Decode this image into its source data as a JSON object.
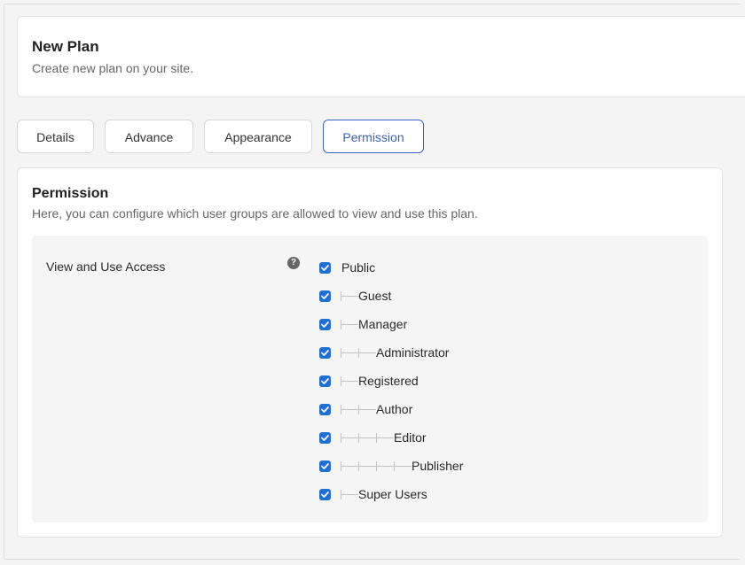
{
  "header": {
    "title": "New Plan",
    "subtitle": "Create new plan on your site."
  },
  "tabs": [
    {
      "label": "Details",
      "active": false
    },
    {
      "label": "Advance",
      "active": false
    },
    {
      "label": "Appearance",
      "active": false
    },
    {
      "label": "Permission",
      "active": true
    }
  ],
  "panel": {
    "title": "Permission",
    "description": "Here, you can configure which user groups are allowed to view and use this plan."
  },
  "field": {
    "label": "View and Use Access",
    "help_icon": "question-circle-icon"
  },
  "groups": [
    {
      "label": "Public",
      "level": 0,
      "checked": true
    },
    {
      "label": "Guest",
      "level": 1,
      "checked": true
    },
    {
      "label": "Manager",
      "level": 1,
      "checked": true
    },
    {
      "label": "Administrator",
      "level": 2,
      "checked": true
    },
    {
      "label": "Registered",
      "level": 1,
      "checked": true
    },
    {
      "label": "Author",
      "level": 2,
      "checked": true
    },
    {
      "label": "Editor",
      "level": 3,
      "checked": true
    },
    {
      "label": "Publisher",
      "level": 4,
      "checked": true
    },
    {
      "label": "Super Users",
      "level": 1,
      "checked": true
    }
  ],
  "colors": {
    "accent": "#3a61c4",
    "checkbox": "#1e6fd9"
  }
}
